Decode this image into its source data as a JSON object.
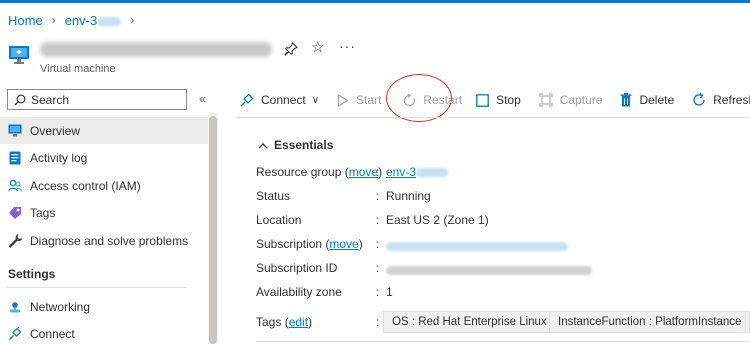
{
  "breadcrumb": {
    "home": "Home",
    "env": "env-3"
  },
  "header": {
    "subtitle": "Virtual machine",
    "more": "···"
  },
  "sidebar": {
    "search_placeholder": "Search",
    "collapse": "«",
    "items": [
      {
        "label": "Overview"
      },
      {
        "label": "Activity log"
      },
      {
        "label": "Access control (IAM)"
      },
      {
        "label": "Tags"
      },
      {
        "label": "Diagnose and solve problems"
      }
    ],
    "settings_header": "Settings",
    "settings_items": [
      {
        "label": "Networking"
      },
      {
        "label": "Connect"
      }
    ]
  },
  "toolbar": {
    "connect": "Connect",
    "start": "Start",
    "restart": "Restart",
    "stop": "Stop",
    "capture": "Capture",
    "delete": "Delete",
    "refresh": "Refresh"
  },
  "essentials": {
    "title": "Essentials",
    "resource_group_label": "Resource group",
    "move_link": "move",
    "resource_group_value": "env-3",
    "status_label": "Status",
    "status_value": "Running",
    "location_label": "Location",
    "location_value": "East US 2 (Zone 1)",
    "subscription_label": "Subscription",
    "subscription_id_label": "Subscription ID",
    "availability_zone_label": "Availability zone",
    "availability_zone_value": "1",
    "tags_label": "Tags",
    "edit_link": "edit",
    "colon": ":",
    "tags": [
      "OS : Red Hat Enterprise Linux",
      "InstanceFunction : PlatformInstance"
    ]
  },
  "colors": {
    "accent": "#0078d4",
    "highlight_circle": "#d6351f"
  }
}
